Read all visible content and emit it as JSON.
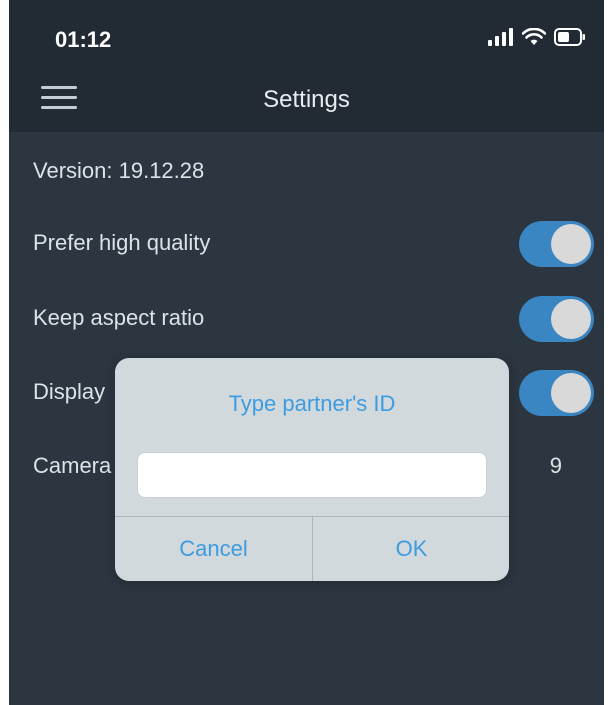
{
  "status_bar": {
    "time": "01:12",
    "icons": [
      "signal-icon",
      "wifi-icon",
      "battery-icon"
    ]
  },
  "nav": {
    "title": "Settings",
    "menu_icon": "hamburger-icon"
  },
  "settings": {
    "version_label": "Version: 19.12.28",
    "rows": [
      {
        "label": "Prefer high quality",
        "type": "toggle",
        "on": true
      },
      {
        "label": "Keep aspect ratio",
        "type": "toggle",
        "on": true
      },
      {
        "label": "Display",
        "type": "toggle",
        "on": true
      },
      {
        "label": "Camera",
        "type": "value",
        "value": "9"
      }
    ]
  },
  "dialog": {
    "title": "Type partner's ID",
    "input_value": "",
    "cancel_label": "Cancel",
    "ok_label": "OK"
  },
  "colors": {
    "background": "#2c3640",
    "topbar": "#222a33",
    "accent": "#3a86c3",
    "dialog_text": "#3d9be0"
  }
}
